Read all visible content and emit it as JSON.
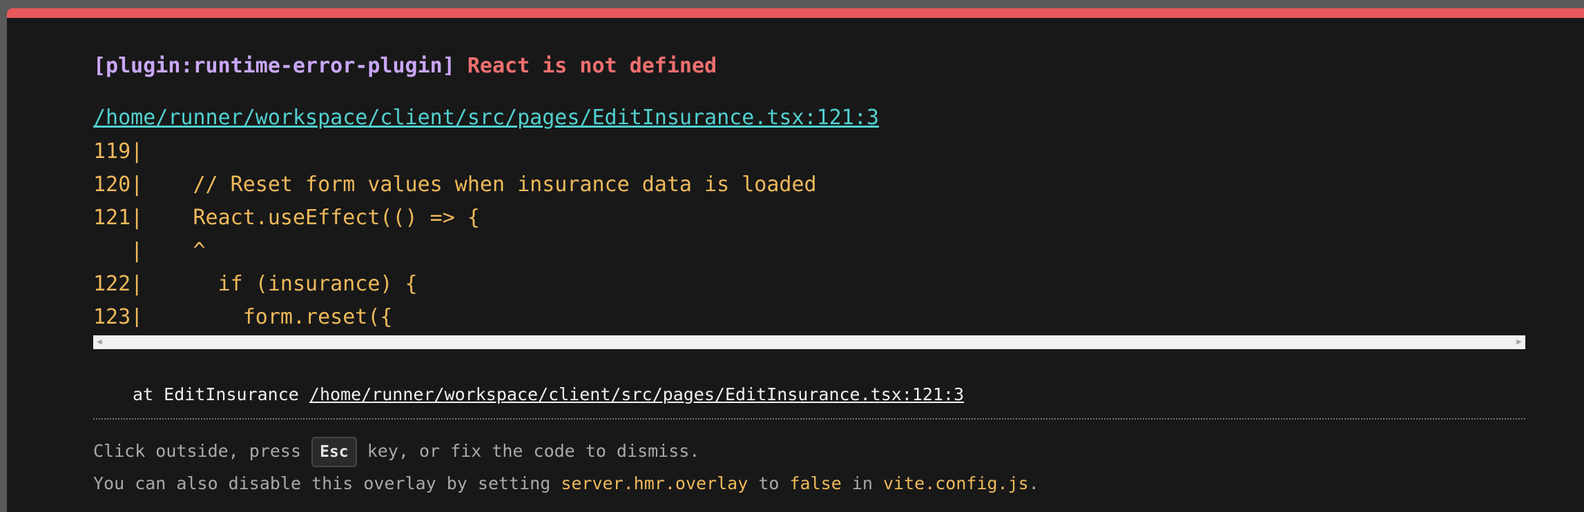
{
  "error": {
    "plugin": "[plugin:runtime-error-plugin]",
    "message": "React is not defined"
  },
  "file_link": "/home/runner/workspace/client/src/pages/EditInsurance.tsx:121:3",
  "code_frame": [
    "119|",
    "120|    // Reset form values when insurance data is loaded",
    "121|    React.useEffect(() => {",
    "   |    ^",
    "122|      if (insurance) {",
    "123|        form.reset({"
  ],
  "stack": {
    "prefix": "at EditInsurance",
    "link": "/home/runner/workspace/client/src/pages/EditInsurance.tsx:121:3"
  },
  "tip": {
    "line1_a": "Click outside, press",
    "key": "Esc",
    "line1_b": "key, or fix the code to dismiss.",
    "line2_a": "You can also disable this overlay by setting",
    "setting": "server.hmr.overlay",
    "line2_b": "to",
    "value": "false",
    "line2_c": "in",
    "config_file": "vite.config.js",
    "line2_d": "."
  },
  "colors": {
    "accent_bar": "#e8585a",
    "plugin": "#c9a7f7",
    "error": "#ef6f6f",
    "link": "#52d1d1",
    "code": "#efb95b"
  }
}
